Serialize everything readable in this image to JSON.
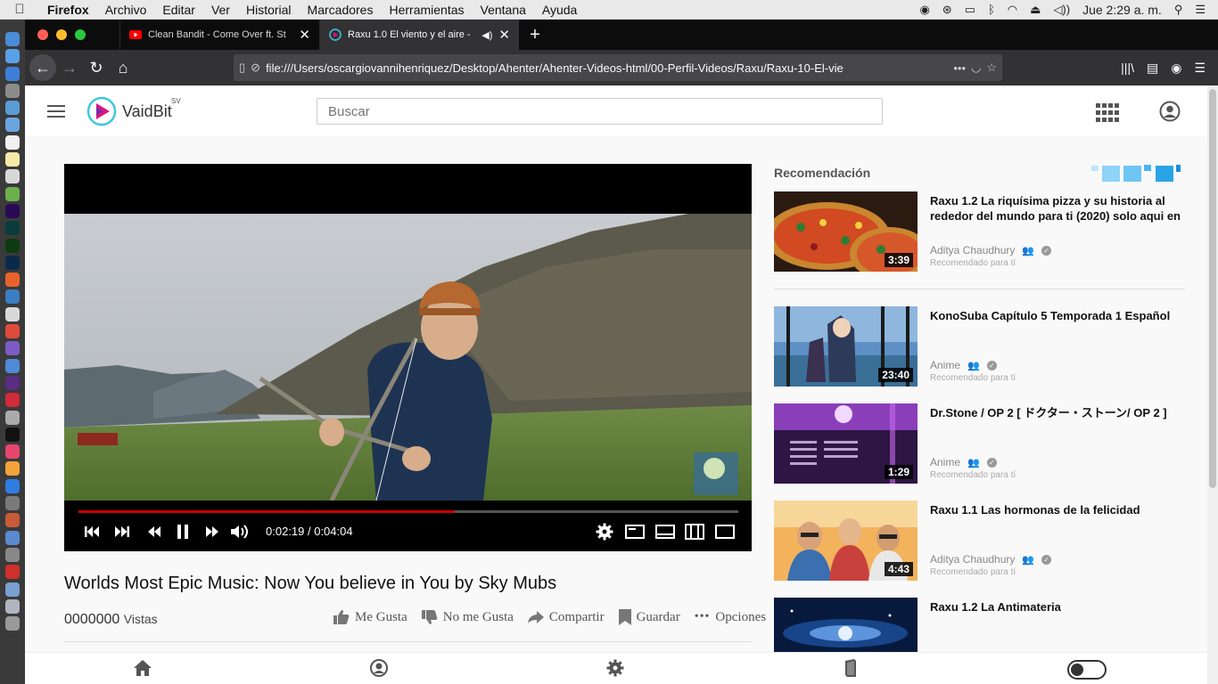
{
  "menubar": {
    "app": "Firefox",
    "items": [
      "Archivo",
      "Editar",
      "Ver",
      "Historial",
      "Marcadores",
      "Herramientas",
      "Ventana",
      "Ayuda"
    ],
    "clock": "Jue 2:29 a. m."
  },
  "tabs": [
    {
      "title": "Clean Bandit - Come Over ft. St",
      "close": "✕"
    },
    {
      "title": "Raxu 1.0 El viento y el aire -",
      "close": "✕"
    }
  ],
  "url": "file:///Users/oscargiovannihenriquez/Desktop/Ahenter/Ahenter-Videos-html/00-Perfil-Videos/Raxu/Raxu-10-El-vie",
  "site": {
    "brand": "VaidBit",
    "brand_sup": "SV",
    "search_placeholder": "Buscar"
  },
  "player": {
    "time": "0:02:19 / 0:04:04",
    "progress": 0.57
  },
  "video": {
    "title": "Worlds Most Epic Music: Now You believe in You by Sky Mubs",
    "views_count": "0000000",
    "views_label": "Vistas",
    "actions": {
      "like": "Me Gusta",
      "dislike": "No me Gusta",
      "share": "Compartir",
      "save": "Guardar",
      "options": "Opciones"
    }
  },
  "recommendations": {
    "heading": "Recomendación",
    "items": [
      {
        "title": "Raxu 1.2 La riquísima pizza y su historia al rededor del mundo para ti (2020) solo aqui en",
        "channel": "Aditya Chaudhury",
        "sub": "Recomendado para tí",
        "duration": "3:39"
      },
      {
        "title": "KonoSuba Capítulo 5 Temporada 1 Español",
        "channel": "Anime",
        "sub": "Recomendado para tí",
        "duration": "23:40"
      },
      {
        "title": "Dr.Stone / OP 2 [ ドクター・ストーン/ OP 2 ]",
        "channel": "Anime",
        "sub": "Recomendado para tí",
        "duration": "1:29"
      },
      {
        "title": "Raxu 1.1 Las hormonas de la felicidad",
        "channel": "Aditya Chaudhury",
        "sub": "Recomendado para tí",
        "duration": "4:43"
      },
      {
        "title": "Raxu 1.2 La Antimateria",
        "channel": "",
        "sub": "",
        "duration": ""
      }
    ]
  },
  "colors": {
    "accent_red": "#cc0000",
    "brand_pink": "#e0157a",
    "brand_cyan": "#3fc6e0",
    "firefox_dark": "#0c0c0d"
  }
}
